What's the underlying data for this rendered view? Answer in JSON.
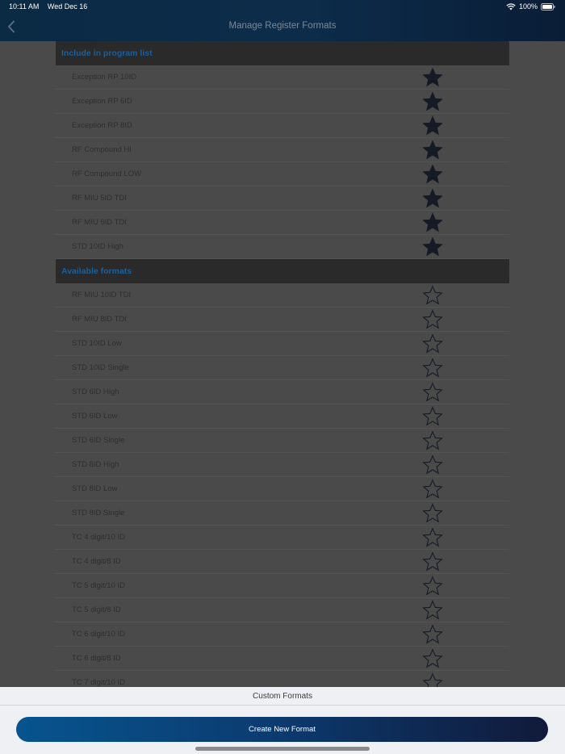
{
  "status_bar": {
    "time": "10:11 AM",
    "date": "Wed Dec 16",
    "battery": "100%"
  },
  "nav": {
    "title": "Manage Register Formats"
  },
  "sections": [
    {
      "header": "Include in program list",
      "items": [
        {
          "label": "Exception RP 10ID",
          "starred": true
        },
        {
          "label": "Exception RP 6ID",
          "starred": true
        },
        {
          "label": "Exception RP 8ID",
          "starred": true
        },
        {
          "label": "RF Compound HI",
          "starred": true
        },
        {
          "label": "RF Compound LOW",
          "starred": true
        },
        {
          "label": "RF MIU 5ID TDI",
          "starred": true
        },
        {
          "label": "RF MIU 6ID TDI",
          "starred": true
        },
        {
          "label": "STD 10ID High",
          "starred": true
        }
      ]
    },
    {
      "header": "Available formats",
      "items": [
        {
          "label": "RF MIU 10ID TDI",
          "starred": false
        },
        {
          "label": "RF MIU 8ID TDI",
          "starred": false
        },
        {
          "label": "STD 10ID Low",
          "starred": false
        },
        {
          "label": "STD 10ID Single",
          "starred": false
        },
        {
          "label": "STD 6ID High",
          "starred": false
        },
        {
          "label": "STD 6ID Low",
          "starred": false
        },
        {
          "label": "STD 6ID Single",
          "starred": false
        },
        {
          "label": "STD 8ID High",
          "starred": false
        },
        {
          "label": "STD 8ID Low",
          "starred": false
        },
        {
          "label": "STD 8ID Single",
          "starred": false
        },
        {
          "label": "TC 4 digit/10 ID",
          "starred": false
        },
        {
          "label": "TC 4 digit/8 ID",
          "starred": false
        },
        {
          "label": "TC 5 digit/10 ID",
          "starred": false
        },
        {
          "label": "TC 5 digit/8 ID",
          "starred": false
        },
        {
          "label": "TC 6 digit/10 ID",
          "starred": false
        },
        {
          "label": "TC 6 digit/8 ID",
          "starred": false
        },
        {
          "label": "TC 7 digit/10 ID",
          "starred": false
        }
      ]
    }
  ],
  "bottom": {
    "title": "Custom Formats",
    "button_label": "Create New Format"
  },
  "icons": {
    "back": "chevron-left-icon",
    "filled_star": "star-filled-icon",
    "empty_star": "star-outline-icon",
    "wifi": "wifi-icon",
    "battery": "battery-icon"
  },
  "colors": {
    "header_bg": "#0b2a44",
    "section_header_text": "#1c5f9a",
    "button_start": "#07548e",
    "button_end": "#111a3a"
  }
}
